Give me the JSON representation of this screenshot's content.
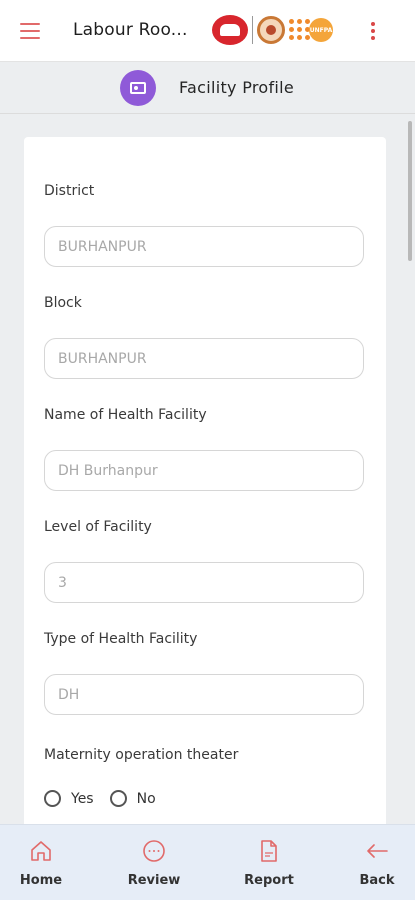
{
  "appbar": {
    "title": "Labour Roo...",
    "logo_text": "UNFPA"
  },
  "section": {
    "title": "Facility Profile"
  },
  "form": {
    "fields": [
      {
        "label": "District",
        "value": "BURHANPUR"
      },
      {
        "label": "Block",
        "value": "BURHANPUR"
      },
      {
        "label": "Name of Health Facility",
        "value": "DH Burhanpur"
      },
      {
        "label": "Level of Facility",
        "value": "3"
      },
      {
        "label": "Type of Health Facility",
        "value": "DH"
      }
    ],
    "radio_question": "Maternity operation theater",
    "radio_options": [
      "Yes",
      "No"
    ]
  },
  "bottom_nav": {
    "items": [
      {
        "label": "Home",
        "icon": "home-icon"
      },
      {
        "label": "Review",
        "icon": "more-circle-icon"
      },
      {
        "label": "Report",
        "icon": "pdf-document-icon"
      },
      {
        "label": "Back",
        "icon": "arrow-left-icon"
      }
    ]
  },
  "colors": {
    "accent": "#e16a6a",
    "section_icon": "#8f5ad8",
    "nav_bg": "#e6edf7"
  }
}
